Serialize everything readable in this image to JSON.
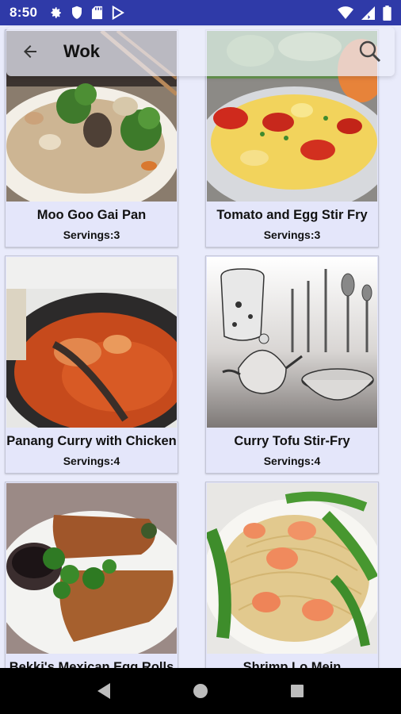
{
  "status_bar": {
    "time": "8:50",
    "left_icons": [
      "gear-icon",
      "shield-icon",
      "sd-card-icon",
      "play-store-icon"
    ],
    "right_icons": [
      "wifi-icon",
      "signal-icon",
      "battery-icon"
    ]
  },
  "search": {
    "query": "Wok",
    "back_icon": "arrow-left-icon",
    "search_icon": "search-icon"
  },
  "recipes": [
    {
      "title": "Moo Goo Gai Pan",
      "servings": "Servings:3"
    },
    {
      "title": "Tomato and Egg Stir Fry",
      "servings": "Servings:3"
    },
    {
      "title": "Panang Curry with Chicken",
      "servings": "Servings:4"
    },
    {
      "title": "Curry Tofu Stir-Fry",
      "servings": "Servings:4"
    },
    {
      "title": "Bekki's Mexican Egg Rolls",
      "servings": ""
    },
    {
      "title": "Shrimp Lo Mein",
      "servings": ""
    }
  ],
  "nav": {
    "back": "back-triangle-icon",
    "home": "home-circle-icon",
    "recents": "recents-square-icon"
  },
  "colors": {
    "status_bar": "#2f3aa8",
    "background": "#e9ebfb",
    "card": "#e4e6fa"
  }
}
